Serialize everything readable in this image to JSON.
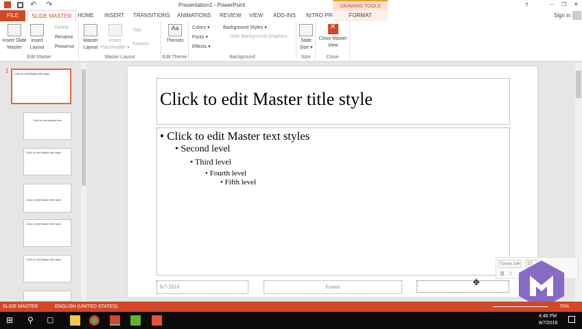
{
  "window": {
    "title": "Presentation1 - PowerPoint",
    "help": "?",
    "minimize": "–",
    "restore": "❐",
    "close": "✕",
    "sign_in": "Sign in"
  },
  "qat": {
    "save": "save-icon",
    "undo": "undo-icon",
    "redo": "redo-icon"
  },
  "tabs": [
    {
      "label": "FILE"
    },
    {
      "label": "SLIDE MASTER"
    },
    {
      "label": "HOME"
    },
    {
      "label": "INSERT"
    },
    {
      "label": "TRANSITIONS"
    },
    {
      "label": "ANIMATIONS"
    },
    {
      "label": "REVIEW"
    },
    {
      "label": "VIEW"
    },
    {
      "label": "ADD-INS"
    },
    {
      "label": "NITRO PRO 10"
    },
    {
      "label": "FORMAT"
    }
  ],
  "contextual": "DRAWING TOOLS",
  "ribbon": {
    "edit_master": {
      "label": "Edit Master",
      "insert_slide_master": "Insert Slide Master",
      "insert_layout": "Insert Layout",
      "delete": "Delete",
      "rename": "Rename",
      "preserve": "Preserve"
    },
    "master_layout": {
      "label": "Master Layout",
      "master_layout": "Master Layout",
      "insert_placeholder": "Insert Placeholder ▾",
      "title": "Title",
      "footers": "Footers"
    },
    "edit_theme": {
      "label": "Edit Theme",
      "themes": "Themes"
    },
    "background": {
      "label": "Background",
      "colors": "Colors ▾",
      "fonts": "Fonts ▾",
      "effects": "Effects ▾",
      "background_styles": "Background Styles ▾",
      "hide_bg": "Hide Background Graphics"
    },
    "size": {
      "label": "Size",
      "slide_size": "Slide Size ▾"
    },
    "close": {
      "label": "Close",
      "close_master": "Close Master View"
    }
  },
  "thumbs": {
    "first_number": "1",
    "titles": [
      "Click to edit Master title style",
      "",
      "Click to edit Master title",
      "",
      "Click to edit Master title style",
      "",
      "Click to edit Master title style"
    ]
  },
  "slide": {
    "title": "Click to edit Master title style",
    "levels": [
      "• Click to edit Master text styles",
      "• Second level",
      "• Third level",
      "• Fourth level",
      "• Fifth level"
    ],
    "date": "8/7/2018",
    "footer": "Footer"
  },
  "mini_toolbar": {
    "font": "Times N▾",
    "size": "12",
    "bold": "B",
    "italic": "I"
  },
  "status": {
    "mode": "SLIDE MASTER",
    "language": "ENGLISH (UNITED STATES)",
    "zoom": "75%"
  },
  "taskbar": {
    "time": "4:48 PM",
    "date": "8/7/2018"
  }
}
